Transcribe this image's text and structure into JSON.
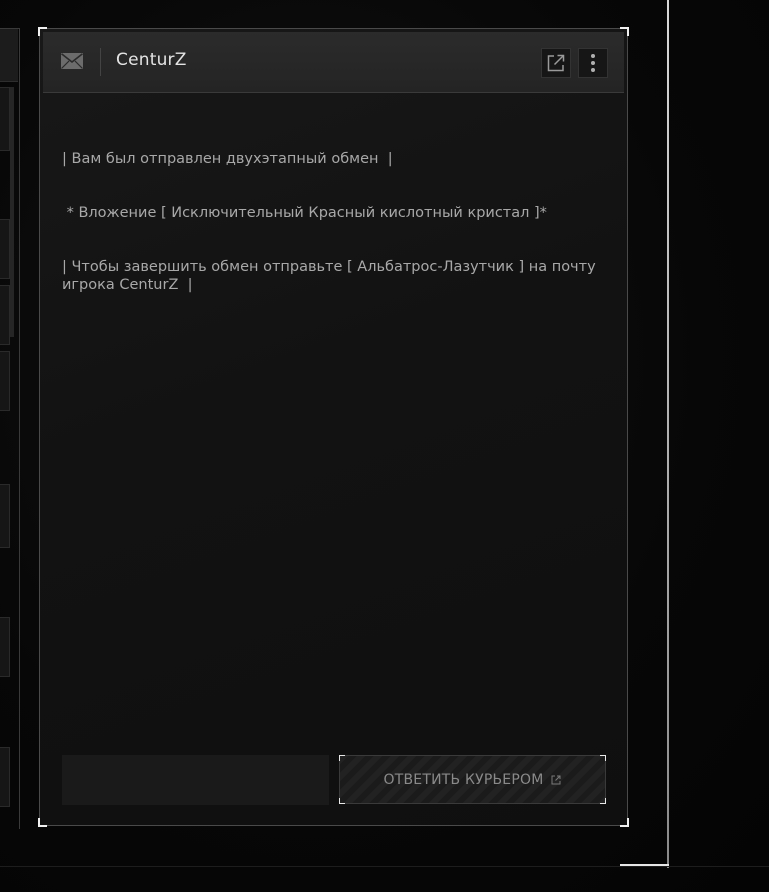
{
  "mail": {
    "sender": "CenturZ",
    "message_lines": [
      "| Вам был отправлен двухэтапный обмен  |",
      " * Вложение [ Исключительный Красный кислотный кристал ]*",
      "| Чтобы завершить обмен отправьте [ Альбатрос-Лазутчик ] на почту игрока CenturZ  |"
    ],
    "reply_input_value": "",
    "courier_button_label": "ОТВЕТИТЬ КУРЬЕРОМ"
  },
  "icons": {
    "envelope": "envelope-icon",
    "external": "external-link-icon",
    "menu": "more-vertical-icon",
    "courier": "external-link-icon"
  },
  "colors": {
    "window_bg": "#141414",
    "header_bg": "#282828",
    "text": "#a8a8a8",
    "accent_corners": "#f0f0f0"
  }
}
